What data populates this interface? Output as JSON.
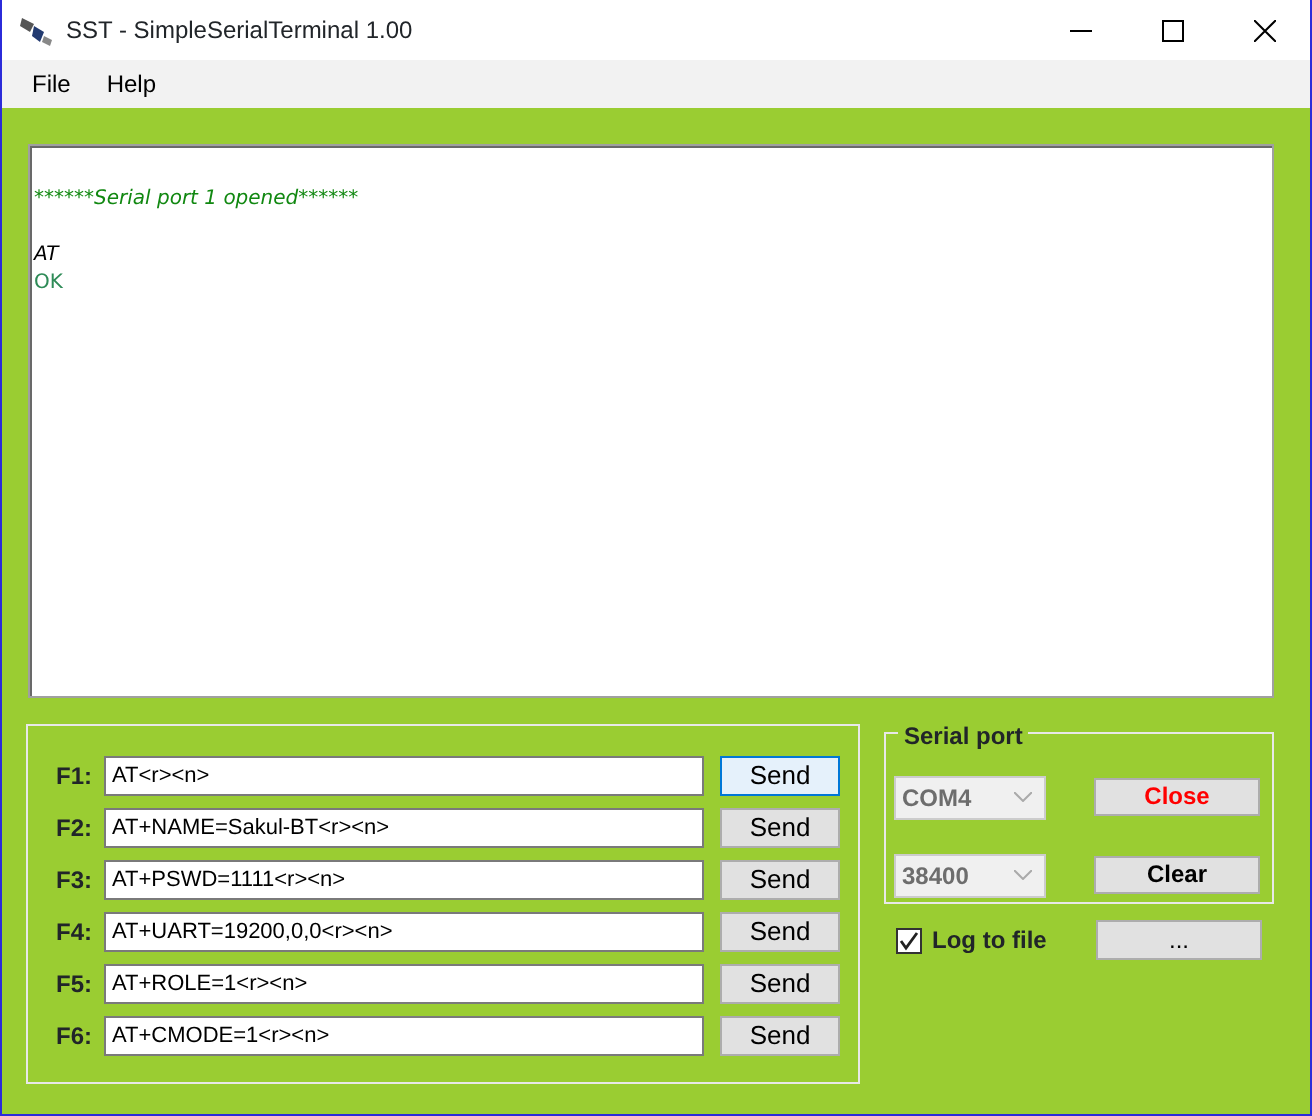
{
  "window": {
    "title": "SST - SimpleSerialTerminal 1.00"
  },
  "menu": [
    "File",
    "Help"
  ],
  "terminal": {
    "lines": [
      {
        "kind": "blank"
      },
      {
        "kind": "info",
        "text": "******Serial port 1 opened******"
      },
      {
        "kind": "blank"
      },
      {
        "kind": "sent",
        "text": "AT"
      },
      {
        "kind": "received",
        "text": "OK"
      }
    ]
  },
  "macros": [
    {
      "label": "F1:",
      "value": "AT<r><n>",
      "button": "Send",
      "focused": true
    },
    {
      "label": "F2:",
      "value": "AT+NAME=Sakul-BT<r><n>",
      "button": "Send",
      "focused": false
    },
    {
      "label": "F3:",
      "value": "AT+PSWD=1111<r><n>",
      "button": "Send",
      "focused": false
    },
    {
      "label": "F4:",
      "value": "AT+UART=19200,0,0<r><n>",
      "button": "Send",
      "focused": false
    },
    {
      "label": "F5:",
      "value": "AT+ROLE=1<r><n>",
      "button": "Send",
      "focused": false
    },
    {
      "label": "F6:",
      "value": "AT+CMODE=1<r><n>",
      "button": "Send",
      "focused": false
    }
  ],
  "serial_port": {
    "title": "Serial port",
    "port": {
      "value": "COM4",
      "disabled": true
    },
    "baud": {
      "value": "38400",
      "disabled": true
    },
    "close_button": "Close",
    "clear_button": "Clear"
  },
  "log_to_file": {
    "label": "Log to file",
    "checked": true
  },
  "browse_button": "..."
}
